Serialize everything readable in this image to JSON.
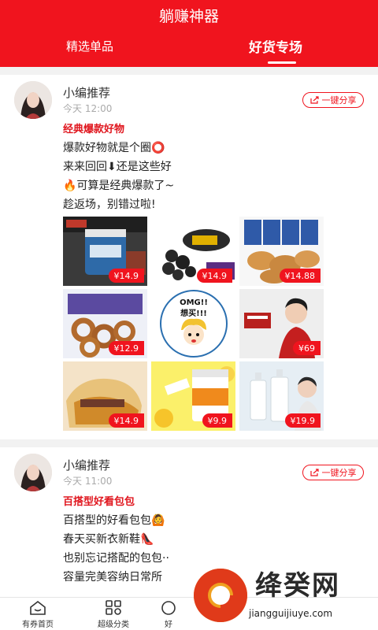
{
  "header": {
    "app_title": "躺赚神器",
    "tabs": [
      {
        "label": "精选单品"
      },
      {
        "label": "好货专场"
      }
    ]
  },
  "posts": [
    {
      "author": "小编推荐",
      "time": "今天 12:00",
      "share_label": "一键分享",
      "headline": "经典爆款好物",
      "lines": [
        "爆款好物就是个圈⭕",
        "来来回回⬇还是这些好",
        "🔥可算是经典爆款了~",
        "趁返场，别错过啦!"
      ],
      "products": [
        {
          "price": "¥14.9",
          "image": "powder-jar"
        },
        {
          "price": "¥14.9",
          "image": "black-fruit"
        },
        {
          "price": "¥14.88",
          "image": "biscuits"
        },
        {
          "price": "¥12.9",
          "image": "donut-cookies"
        },
        {
          "price": "",
          "image": "omg-cartoon",
          "text": "OMG!!\n想买!!!"
        },
        {
          "price": "¥69",
          "image": "celebrity-product"
        },
        {
          "price": "¥14.9",
          "image": "cake"
        },
        {
          "price": "¥9.9",
          "image": "vitamin-c"
        },
        {
          "price": "¥19.9",
          "image": "serum-bottles"
        }
      ]
    },
    {
      "author": "小编推荐",
      "time": "今天 11:00",
      "share_label": "一键分享",
      "headline": "百搭型好看包包",
      "lines": [
        "百搭型的好看包包🙆",
        "春天买新衣新鞋👠",
        "也别忘记搭配的包包··",
        "容量完美容纳日常所"
      ]
    }
  ],
  "nav": [
    {
      "label": "有券首页",
      "icon": "home-icon"
    },
    {
      "label": "超级分类",
      "icon": "category-icon"
    },
    {
      "label": "好",
      "icon": "good-icon"
    }
  ],
  "watermark": {
    "text": "绛癸网",
    "url": "jiangguijiuye.com"
  },
  "colors": {
    "brand": "#f0141e"
  }
}
